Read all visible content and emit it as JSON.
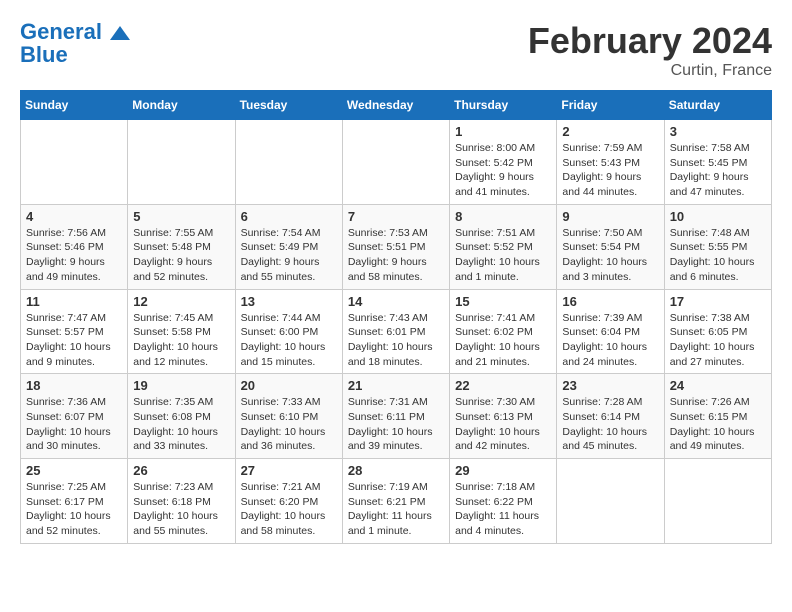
{
  "header": {
    "logo_line1": "General",
    "logo_line2": "Blue",
    "month": "February 2024",
    "location": "Curtin, France"
  },
  "days_of_week": [
    "Sunday",
    "Monday",
    "Tuesday",
    "Wednesday",
    "Thursday",
    "Friday",
    "Saturday"
  ],
  "weeks": [
    [
      {
        "day": "",
        "info": ""
      },
      {
        "day": "",
        "info": ""
      },
      {
        "day": "",
        "info": ""
      },
      {
        "day": "",
        "info": ""
      },
      {
        "day": "1",
        "info": "Sunrise: 8:00 AM\nSunset: 5:42 PM\nDaylight: 9 hours\nand 41 minutes."
      },
      {
        "day": "2",
        "info": "Sunrise: 7:59 AM\nSunset: 5:43 PM\nDaylight: 9 hours\nand 44 minutes."
      },
      {
        "day": "3",
        "info": "Sunrise: 7:58 AM\nSunset: 5:45 PM\nDaylight: 9 hours\nand 47 minutes."
      }
    ],
    [
      {
        "day": "4",
        "info": "Sunrise: 7:56 AM\nSunset: 5:46 PM\nDaylight: 9 hours\nand 49 minutes."
      },
      {
        "day": "5",
        "info": "Sunrise: 7:55 AM\nSunset: 5:48 PM\nDaylight: 9 hours\nand 52 minutes."
      },
      {
        "day": "6",
        "info": "Sunrise: 7:54 AM\nSunset: 5:49 PM\nDaylight: 9 hours\nand 55 minutes."
      },
      {
        "day": "7",
        "info": "Sunrise: 7:53 AM\nSunset: 5:51 PM\nDaylight: 9 hours\nand 58 minutes."
      },
      {
        "day": "8",
        "info": "Sunrise: 7:51 AM\nSunset: 5:52 PM\nDaylight: 10 hours\nand 1 minute."
      },
      {
        "day": "9",
        "info": "Sunrise: 7:50 AM\nSunset: 5:54 PM\nDaylight: 10 hours\nand 3 minutes."
      },
      {
        "day": "10",
        "info": "Sunrise: 7:48 AM\nSunset: 5:55 PM\nDaylight: 10 hours\nand 6 minutes."
      }
    ],
    [
      {
        "day": "11",
        "info": "Sunrise: 7:47 AM\nSunset: 5:57 PM\nDaylight: 10 hours\nand 9 minutes."
      },
      {
        "day": "12",
        "info": "Sunrise: 7:45 AM\nSunset: 5:58 PM\nDaylight: 10 hours\nand 12 minutes."
      },
      {
        "day": "13",
        "info": "Sunrise: 7:44 AM\nSunset: 6:00 PM\nDaylight: 10 hours\nand 15 minutes."
      },
      {
        "day": "14",
        "info": "Sunrise: 7:43 AM\nSunset: 6:01 PM\nDaylight: 10 hours\nand 18 minutes."
      },
      {
        "day": "15",
        "info": "Sunrise: 7:41 AM\nSunset: 6:02 PM\nDaylight: 10 hours\nand 21 minutes."
      },
      {
        "day": "16",
        "info": "Sunrise: 7:39 AM\nSunset: 6:04 PM\nDaylight: 10 hours\nand 24 minutes."
      },
      {
        "day": "17",
        "info": "Sunrise: 7:38 AM\nSunset: 6:05 PM\nDaylight: 10 hours\nand 27 minutes."
      }
    ],
    [
      {
        "day": "18",
        "info": "Sunrise: 7:36 AM\nSunset: 6:07 PM\nDaylight: 10 hours\nand 30 minutes."
      },
      {
        "day": "19",
        "info": "Sunrise: 7:35 AM\nSunset: 6:08 PM\nDaylight: 10 hours\nand 33 minutes."
      },
      {
        "day": "20",
        "info": "Sunrise: 7:33 AM\nSunset: 6:10 PM\nDaylight: 10 hours\nand 36 minutes."
      },
      {
        "day": "21",
        "info": "Sunrise: 7:31 AM\nSunset: 6:11 PM\nDaylight: 10 hours\nand 39 minutes."
      },
      {
        "day": "22",
        "info": "Sunrise: 7:30 AM\nSunset: 6:13 PM\nDaylight: 10 hours\nand 42 minutes."
      },
      {
        "day": "23",
        "info": "Sunrise: 7:28 AM\nSunset: 6:14 PM\nDaylight: 10 hours\nand 45 minutes."
      },
      {
        "day": "24",
        "info": "Sunrise: 7:26 AM\nSunset: 6:15 PM\nDaylight: 10 hours\nand 49 minutes."
      }
    ],
    [
      {
        "day": "25",
        "info": "Sunrise: 7:25 AM\nSunset: 6:17 PM\nDaylight: 10 hours\nand 52 minutes."
      },
      {
        "day": "26",
        "info": "Sunrise: 7:23 AM\nSunset: 6:18 PM\nDaylight: 10 hours\nand 55 minutes."
      },
      {
        "day": "27",
        "info": "Sunrise: 7:21 AM\nSunset: 6:20 PM\nDaylight: 10 hours\nand 58 minutes."
      },
      {
        "day": "28",
        "info": "Sunrise: 7:19 AM\nSunset: 6:21 PM\nDaylight: 11 hours\nand 1 minute."
      },
      {
        "day": "29",
        "info": "Sunrise: 7:18 AM\nSunset: 6:22 PM\nDaylight: 11 hours\nand 4 minutes."
      },
      {
        "day": "",
        "info": ""
      },
      {
        "day": "",
        "info": ""
      }
    ]
  ]
}
